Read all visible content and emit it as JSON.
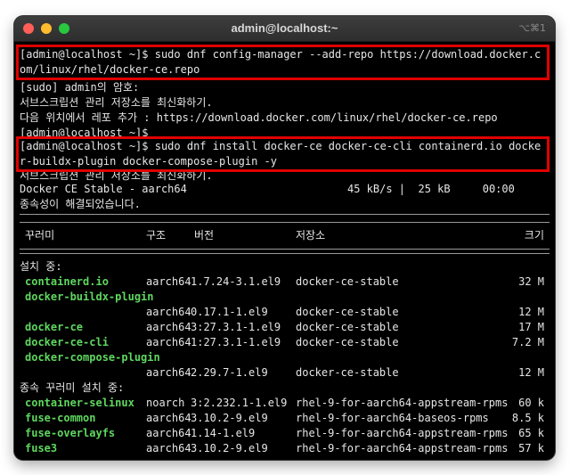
{
  "window": {
    "title": "admin@localhost:~",
    "shortcut": "⌥⌘1"
  },
  "lines": {
    "cmd1": "[admin@localhost ~]$ sudo dnf config-manager --add-repo https://download.docker.com/linux/rhel/docker-ce.repo",
    "sudo": "[sudo] admin의 암호:",
    "refresh1": "서브스크립션 관리 저장소를 최신화하기.",
    "addrepo": "다음 위치에서 레포 추가 : https://download.docker.com/linux/rhel/docker-ce.repo",
    "prompt_cut": "[admin@localhost ~]$",
    "cmd2": "[admin@localhost ~]$ sudo dnf install docker-ce docker-ce-cli containerd.io docker-buildx-plugin docker-compose-plugin -y",
    "refresh2": "서브스크립션 관리 저장소를 최신화하기.",
    "repo_name": "Docker CE Stable - aarch64",
    "repo_speed": "45 kB/s |  25 kB     00:00",
    "deps_resolved": "종속성이 해결되었습니다."
  },
  "table": {
    "headers": [
      "꾸러미",
      "구조",
      "버전",
      "저장소",
      "크기"
    ],
    "installing_label": "설치 중:",
    "deps_label": "종속 꾸러미 설치 중:",
    "packages": [
      {
        "name": "containerd.io",
        "arch": "aarch64",
        "version": "1.7.24-3.1.el9",
        "repo": "docker-ce-stable",
        "size": "32 M"
      },
      {
        "name": "docker-buildx-plugin",
        "arch": "aarch64",
        "version": "0.17.1-1.el9",
        "repo": "docker-ce-stable",
        "size": "12 M"
      },
      {
        "name": "docker-ce",
        "arch": "aarch64",
        "version": "3:27.3.1-1.el9",
        "repo": "docker-ce-stable",
        "size": "17 M"
      },
      {
        "name": "docker-ce-cli",
        "arch": "aarch64",
        "version": "1:27.3.1-1.el9",
        "repo": "docker-ce-stable",
        "size": "7.2 M"
      },
      {
        "name": "docker-compose-plugin",
        "arch": "aarch64",
        "version": "2.29.7-1.el9",
        "repo": "docker-ce-stable",
        "size": "12 M"
      }
    ],
    "deps": [
      {
        "name": "container-selinux",
        "arch": "noarch",
        "version": "3:2.232.1-1.el9",
        "repo": "rhel-9-for-aarch64-appstream-rpms",
        "size": "60 k"
      },
      {
        "name": "fuse-common",
        "arch": "aarch64",
        "version": "3.10.2-9.el9",
        "repo": "rhel-9-for-aarch64-baseos-rpms",
        "size": "8.5 k"
      },
      {
        "name": "fuse-overlayfs",
        "arch": "aarch64",
        "version": "1.14-1.el9",
        "repo": "rhel-9-for-aarch64-appstream-rpms",
        "size": "65 k"
      },
      {
        "name": "fuse3",
        "arch": "aarch64",
        "version": "3.10.2-9.el9",
        "repo": "rhel-9-for-aarch64-appstream-rpms",
        "size": "57 k"
      }
    ]
  },
  "colors": {
    "highlight_box": "#e00000",
    "package_name": "#5fd75f",
    "background": "#000000"
  }
}
